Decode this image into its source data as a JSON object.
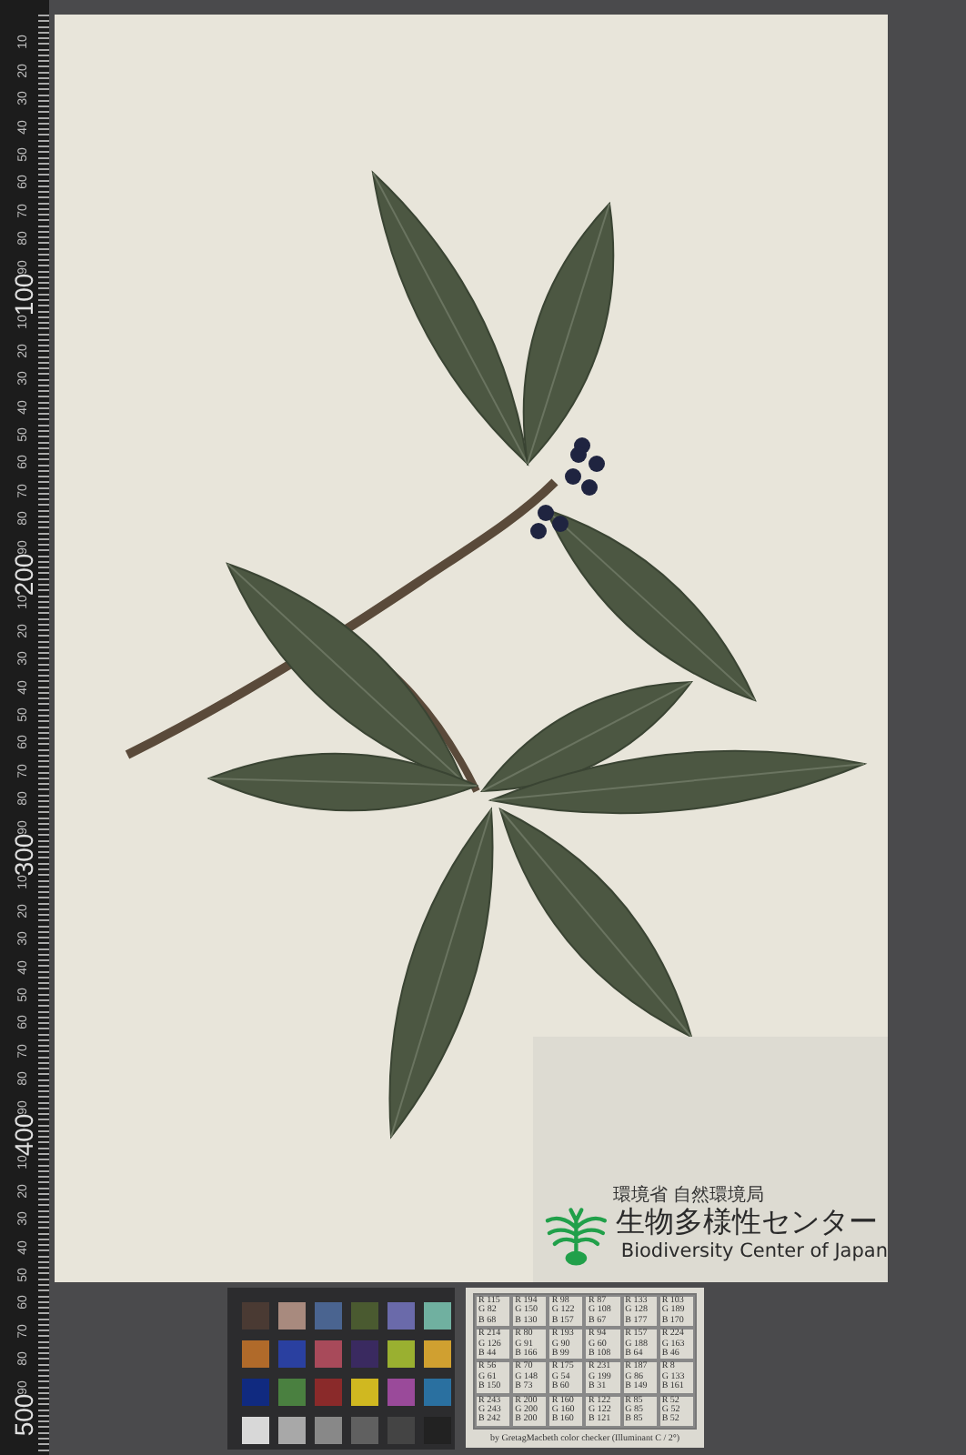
{
  "ruler": {
    "labels": [
      "10",
      "20",
      "30",
      "40",
      "50",
      "60",
      "70",
      "80",
      "90",
      "100",
      "10",
      "20",
      "30",
      "40",
      "50",
      "60",
      "70",
      "80",
      "90",
      "200",
      "10",
      "20",
      "30",
      "40",
      "50",
      "60",
      "70",
      "80",
      "90",
      "300",
      "10",
      "20",
      "30",
      "40",
      "50",
      "60",
      "70",
      "80",
      "90",
      "400",
      "10",
      "20",
      "30",
      "40",
      "50",
      "60",
      "70",
      "80",
      "90",
      "500"
    ]
  },
  "label": {
    "agency": "環境省 自然環境局",
    "name": "生物多様性センター",
    "name_en": "Biodiversity Center of Japan"
  },
  "color_checker": {
    "swatches": [
      {
        "color": "#4a3a33"
      },
      {
        "color": "#a88a7e"
      },
      {
        "color": "#4a6490"
      },
      {
        "color": "#4a5a30"
      },
      {
        "color": "#6a6aaa"
      },
      {
        "color": "#70b0a0"
      },
      {
        "color": "#b06a2a"
      },
      {
        "color": "#2a40a0"
      },
      {
        "color": "#a84a5a"
      },
      {
        "color": "#3a2a60"
      },
      {
        "color": "#9ab030"
      },
      {
        "color": "#d0a030"
      },
      {
        "color": "#102a80"
      },
      {
        "color": "#4a8040"
      },
      {
        "color": "#8a2a2a"
      },
      {
        "color": "#d0b820"
      },
      {
        "color": "#9a4a9a"
      },
      {
        "color": "#2a70a0"
      },
      {
        "color": "#d8d8d8"
      },
      {
        "color": "#a8a8a8"
      },
      {
        "color": "#888888"
      },
      {
        "color": "#606060"
      },
      {
        "color": "#444444"
      },
      {
        "color": "#222222"
      }
    ]
  },
  "reference_table": {
    "cells": [
      [
        "R 115",
        "G 82",
        "B 68"
      ],
      [
        "R 194",
        "G 150",
        "B 130"
      ],
      [
        "R 98",
        "G 122",
        "B 157"
      ],
      [
        "R 87",
        "G 108",
        "B 67"
      ],
      [
        "R 133",
        "G 128",
        "B 177"
      ],
      [
        "R 103",
        "G 189",
        "B 170"
      ],
      [
        "R 214",
        "G 126",
        "B 44"
      ],
      [
        "R 80",
        "G 91",
        "B 166"
      ],
      [
        "R 193",
        "G 90",
        "B 99"
      ],
      [
        "R 94",
        "G 60",
        "B 108"
      ],
      [
        "R 157",
        "G 188",
        "B 64"
      ],
      [
        "R 224",
        "G 163",
        "B 46"
      ],
      [
        "R 56",
        "G 61",
        "B 150"
      ],
      [
        "R 70",
        "G 148",
        "B 73"
      ],
      [
        "R 175",
        "G 54",
        "B 60"
      ],
      [
        "R 231",
        "G 199",
        "B 31"
      ],
      [
        "R 187",
        "G 86",
        "B 149"
      ],
      [
        "R 8",
        "G 133",
        "B 161"
      ],
      [
        "R 243",
        "G 243",
        "B 242"
      ],
      [
        "R 200",
        "G 200",
        "B 200"
      ],
      [
        "R 160",
        "G 160",
        "B 160"
      ],
      [
        "R 122",
        "G 122",
        "B 121"
      ],
      [
        "R 85",
        "G 85",
        "B 85"
      ],
      [
        "R 52",
        "G 52",
        "B 52"
      ]
    ],
    "caption": "by GretagMacbeth color checker (Illuminant C / 2°)"
  }
}
